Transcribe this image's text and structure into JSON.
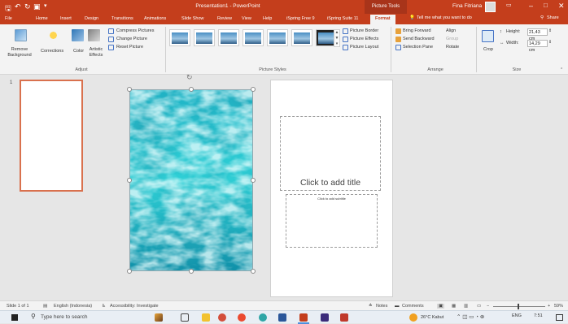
{
  "window": {
    "title": "Presentation1 - PowerPoint",
    "context_tab_group": "Picture Tools",
    "user": "Fina Fitriana"
  },
  "tabs": [
    {
      "label": "File"
    },
    {
      "label": "Home"
    },
    {
      "label": "Insert"
    },
    {
      "label": "Design"
    },
    {
      "label": "Transitions"
    },
    {
      "label": "Animations"
    },
    {
      "label": "Slide Show"
    },
    {
      "label": "Review"
    },
    {
      "label": "View"
    },
    {
      "label": "Help"
    },
    {
      "label": "iSpring Free 9"
    },
    {
      "label": "iSpring Suite 11"
    },
    {
      "label": "Format"
    }
  ],
  "tell_me": "Tell me what you want to do",
  "share": "Share",
  "ribbon": {
    "adjust": {
      "remove_background": "Remove Background",
      "corrections": "Corrections",
      "color": "Color",
      "artistic_effects": "Artistic Effects",
      "compress_pictures": "Compress Pictures",
      "change_picture": "Change Picture",
      "reset_picture": "Reset Picture",
      "group_label": "Adjust"
    },
    "picture_styles": {
      "picture_border": "Picture Border",
      "picture_effects": "Picture Effects",
      "picture_layout": "Picture Layout",
      "group_label": "Picture Styles"
    },
    "arrange": {
      "bring_forward": "Bring Forward",
      "send_backward": "Send Backward",
      "selection_pane": "Selection Pane",
      "align": "Align",
      "group": "Group",
      "rotate": "Rotate",
      "group_label": "Arrange"
    },
    "size": {
      "crop": "Crop",
      "height_label": "Height:",
      "height_value": "21,43 cm",
      "width_label": "Width:",
      "width_value": "14,29 cm",
      "group_label": "Size"
    }
  },
  "slides_pane": {
    "slide_number": "1"
  },
  "slide": {
    "title_placeholder": "Click to add title",
    "subtitle_placeholder": "Click to add subtitle"
  },
  "statusbar": {
    "slide_info": "Slide 1 of 1",
    "language": "English (Indonesia)",
    "accessibility": "Accessibility: Investigate",
    "notes": "Notes",
    "comments": "Comments",
    "zoom": "59%"
  },
  "taskbar": {
    "search_placeholder": "Type here to search",
    "weather": "26°C  Kabut",
    "language": "ENG",
    "time": "7:51"
  }
}
